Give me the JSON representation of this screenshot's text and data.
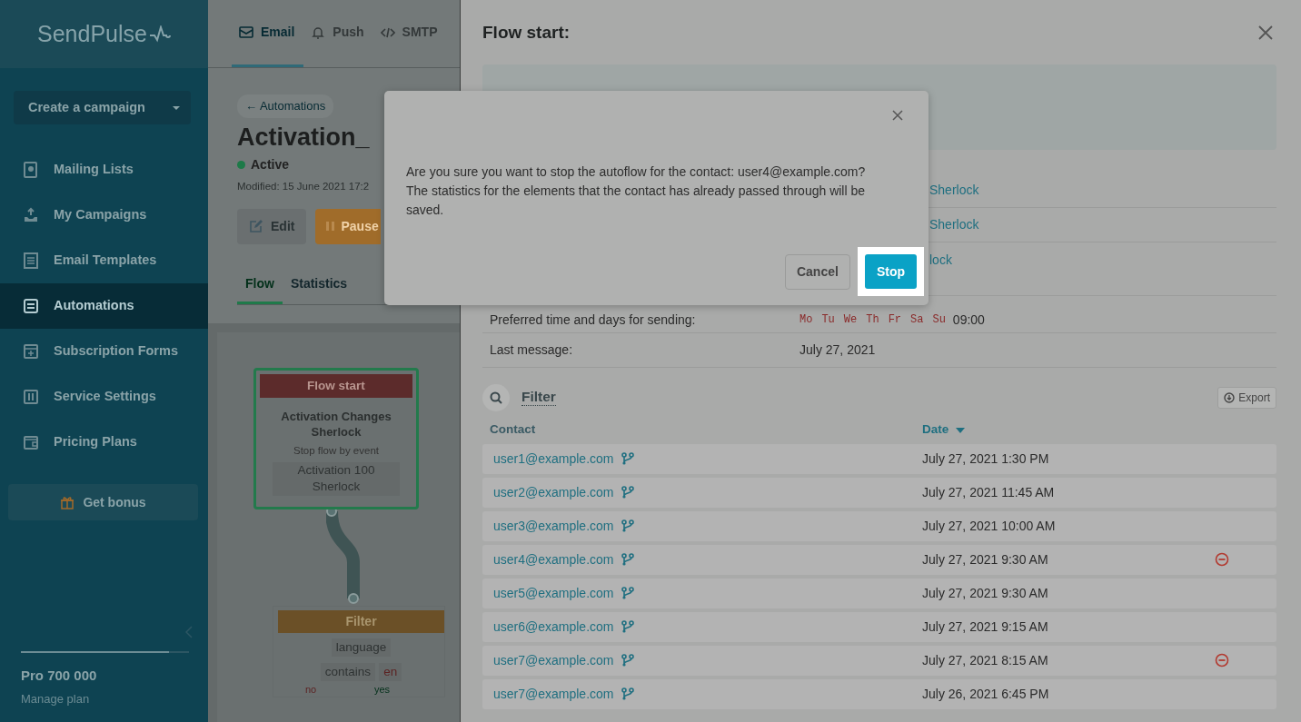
{
  "sidebar": {
    "logo": "SendPulse",
    "create_button": "Create a campaign",
    "items": [
      {
        "label": "Mailing Lists",
        "selected": false
      },
      {
        "label": "My Campaigns",
        "selected": false
      },
      {
        "label": "Email Templates",
        "selected": false
      },
      {
        "label": "Automations",
        "selected": true
      },
      {
        "label": "Subscription Forms",
        "selected": false
      },
      {
        "label": "Service Settings",
        "selected": false
      },
      {
        "label": "Pricing Plans",
        "selected": false
      }
    ],
    "bonus_button": "Get bonus",
    "plan": {
      "name": "Pro 700 000",
      "link": "Manage plan",
      "level": 0.88
    }
  },
  "top_nav": [
    {
      "label": "Email",
      "selected": true
    },
    {
      "label": "Push",
      "selected": false
    },
    {
      "label": "SMTP",
      "selected": false
    }
  ],
  "campaign": {
    "back_link": "← Automations",
    "title": "Activation_",
    "status": "Active",
    "modified": "Modified: 15 June 2021 17:2",
    "buttons": [
      {
        "kind": "edit",
        "label": "Edit"
      },
      {
        "kind": "pause",
        "label": "Pause"
      }
    ],
    "tabs": [
      {
        "label": "Flow",
        "selected": true
      },
      {
        "label": "Statistics",
        "selected": false
      }
    ]
  },
  "flow": {
    "start": {
      "header": "Flow start",
      "title": "Activation Changes Sherlock",
      "subtitle": "Stop flow by event",
      "event": "Activation 100 Sherlock"
    },
    "filter": {
      "header": "Filter",
      "field": "language",
      "operator": "contains",
      "value": "en",
      "no": "no",
      "yes": "yes"
    }
  },
  "drawer": {
    "title": "Flow start:",
    "details": [
      {
        "kind": "link",
        "value": "Sherlock"
      },
      {
        "kind": "link",
        "value": "Sherlock"
      },
      {
        "kind": "link",
        "value": "lock"
      },
      {
        "kind": "days",
        "label": "Preferred time and days for sending:",
        "days": [
          "Mo",
          "Tu",
          "We",
          "Th",
          "Fr",
          "Sa",
          "Su"
        ],
        "time": "09:00"
      },
      {
        "kind": "text",
        "label": "Last message:",
        "value": "July 27, 2021"
      }
    ],
    "filter_label": "Filter",
    "export_button": "Export",
    "columns": [
      {
        "label": "Contact",
        "sorted": false
      },
      {
        "label": "Date",
        "sorted": true
      }
    ],
    "rows": [
      {
        "contact": "user1@example.com",
        "date": "July 27, 2021 1:30 PM",
        "stoppable": false
      },
      {
        "contact": "user2@example.com",
        "date": "July 27, 2021 11:45 AM",
        "stoppable": false
      },
      {
        "contact": "user3@example.com",
        "date": "July 27, 2021 10:00 AM",
        "stoppable": false
      },
      {
        "contact": "user4@example.com",
        "date": "July 27, 2021 9:30 AM",
        "stoppable": true
      },
      {
        "contact": "user5@example.com",
        "date": "July 27, 2021 9:30 AM",
        "stoppable": false
      },
      {
        "contact": "user6@example.com",
        "date": "July 27, 2021 9:15 AM",
        "stoppable": false
      },
      {
        "contact": "user7@example.com",
        "date": "July 27, 2021 8:15 AM",
        "stoppable": true
      },
      {
        "contact": "user7@example.com",
        "date": "July 26, 2021 6:45 PM",
        "stoppable": false
      }
    ]
  },
  "dialog": {
    "message": "Are you sure you want to stop the autoflow for the contact: user4@example.com? The statistics for the elements that the contact has already passed through will be saved.",
    "buttons": [
      {
        "kind": "secondary",
        "label": "Cancel",
        "highlighted": false
      },
      {
        "kind": "primary",
        "label": "Stop",
        "highlighted": true
      }
    ]
  }
}
